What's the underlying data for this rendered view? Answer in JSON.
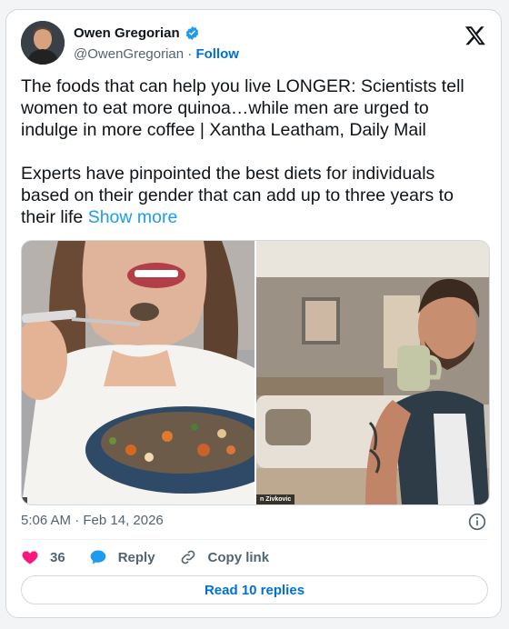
{
  "author": {
    "display_name": "Owen Gregorian",
    "handle": "@OwenGregorian",
    "separator": " · ",
    "follow_label": "Follow"
  },
  "tweet": {
    "headline": "The foods that can help you live LONGER: Scientists tell women to eat more quinoa…while men are urged to indulge in more coffee | Xantha Leatham, Daily Mail",
    "body": "Experts have pinpointed the best diets for individuals based on their gender that can add up to three years to their life ",
    "show_more_label": "Show more"
  },
  "media": {
    "right_credit": "n Zivkovic"
  },
  "meta": {
    "timestamp": "5:06 AM · Feb 14, 2026"
  },
  "actions": {
    "like_count": "36",
    "reply_label": "Reply",
    "copy_link_label": "Copy link",
    "read_replies_label": "Read 10 replies"
  },
  "colors": {
    "like": "#f91880",
    "link": "#006fd6",
    "show_more": "#1d9bf0",
    "verified": "#1d9bf0"
  }
}
